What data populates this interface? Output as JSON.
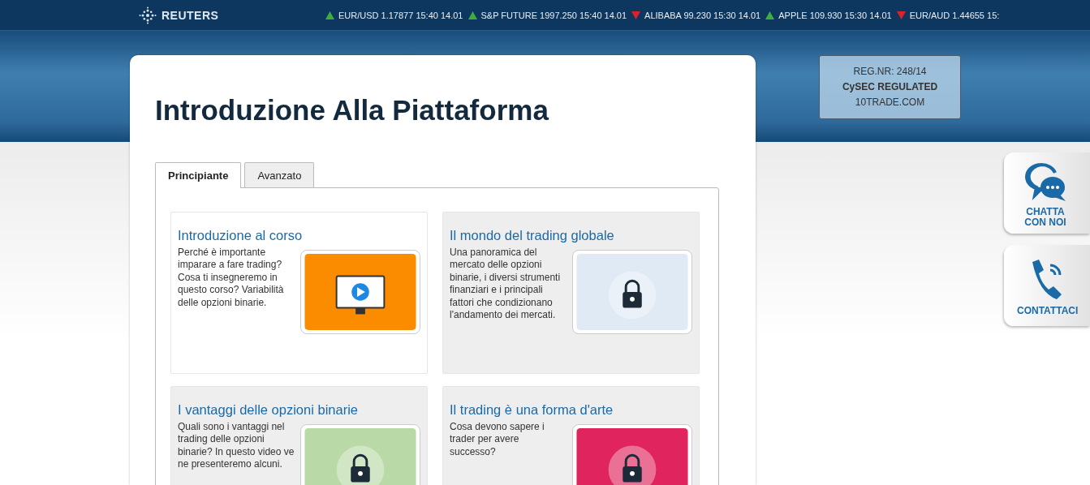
{
  "header": {
    "logo": "REUTERS",
    "ticker": [
      {
        "rising": true,
        "text": "EUR/USD 1.17877 15:40 14.01"
      },
      {
        "rising": true,
        "text": "S&P FUTURE 1997.250 15:40 14.01"
      },
      {
        "rising": false,
        "text": "ALIBABA 99.230 15:30 14.01"
      },
      {
        "rising": true,
        "text": "APPLE 109.930 15:30 14.01"
      },
      {
        "rising": false,
        "text": "EUR/AUD 1.44655 15:"
      }
    ]
  },
  "regulation": {
    "line_1": "REG.NR: 248/14",
    "line_2": "CySEC REGULATED",
    "line_3": "10TRADE.COM"
  },
  "page_title": "Introduzione Alla Piattaforma",
  "tabs": [
    {
      "label": "Principiante",
      "selected": true
    },
    {
      "label": "Avanzato",
      "selected": false
    }
  ],
  "courses": [
    {
      "title": "Introduzione al corso",
      "description": "Perché è importante imparare a fare trading? Cosa ti insegneremo in questo corso? Variabilità delle opzioni binarie.",
      "selected": true,
      "locked": false,
      "color": "#fb8c00"
    },
    {
      "title": "Il mondo del trading globale",
      "description": "Una panoramica del mercato delle opzioni binarie, i diversi strumenti finanziari e i principali fattori che condizionano l'andamento dei mercati.",
      "selected": false,
      "locked": true,
      "color": "#dfeaf5"
    },
    {
      "title": "I vantaggi delle opzioni binarie",
      "description": "Quali sono i vantaggi nel trading delle opzioni binarie? In questo video ve ne presenteremo alcuni.",
      "selected": false,
      "locked": true,
      "color": "#b9d9a6"
    },
    {
      "title": "Il trading è una forma d'arte",
      "description": "Cosa devono sapere i trader per avere successo?",
      "selected": false,
      "locked": true,
      "color": "#e0245e"
    }
  ],
  "side_buttons": [
    {
      "kind": "chat",
      "label": "CHATTA CON NOI"
    },
    {
      "kind": "phone",
      "label": "CONTATTACI"
    }
  ]
}
